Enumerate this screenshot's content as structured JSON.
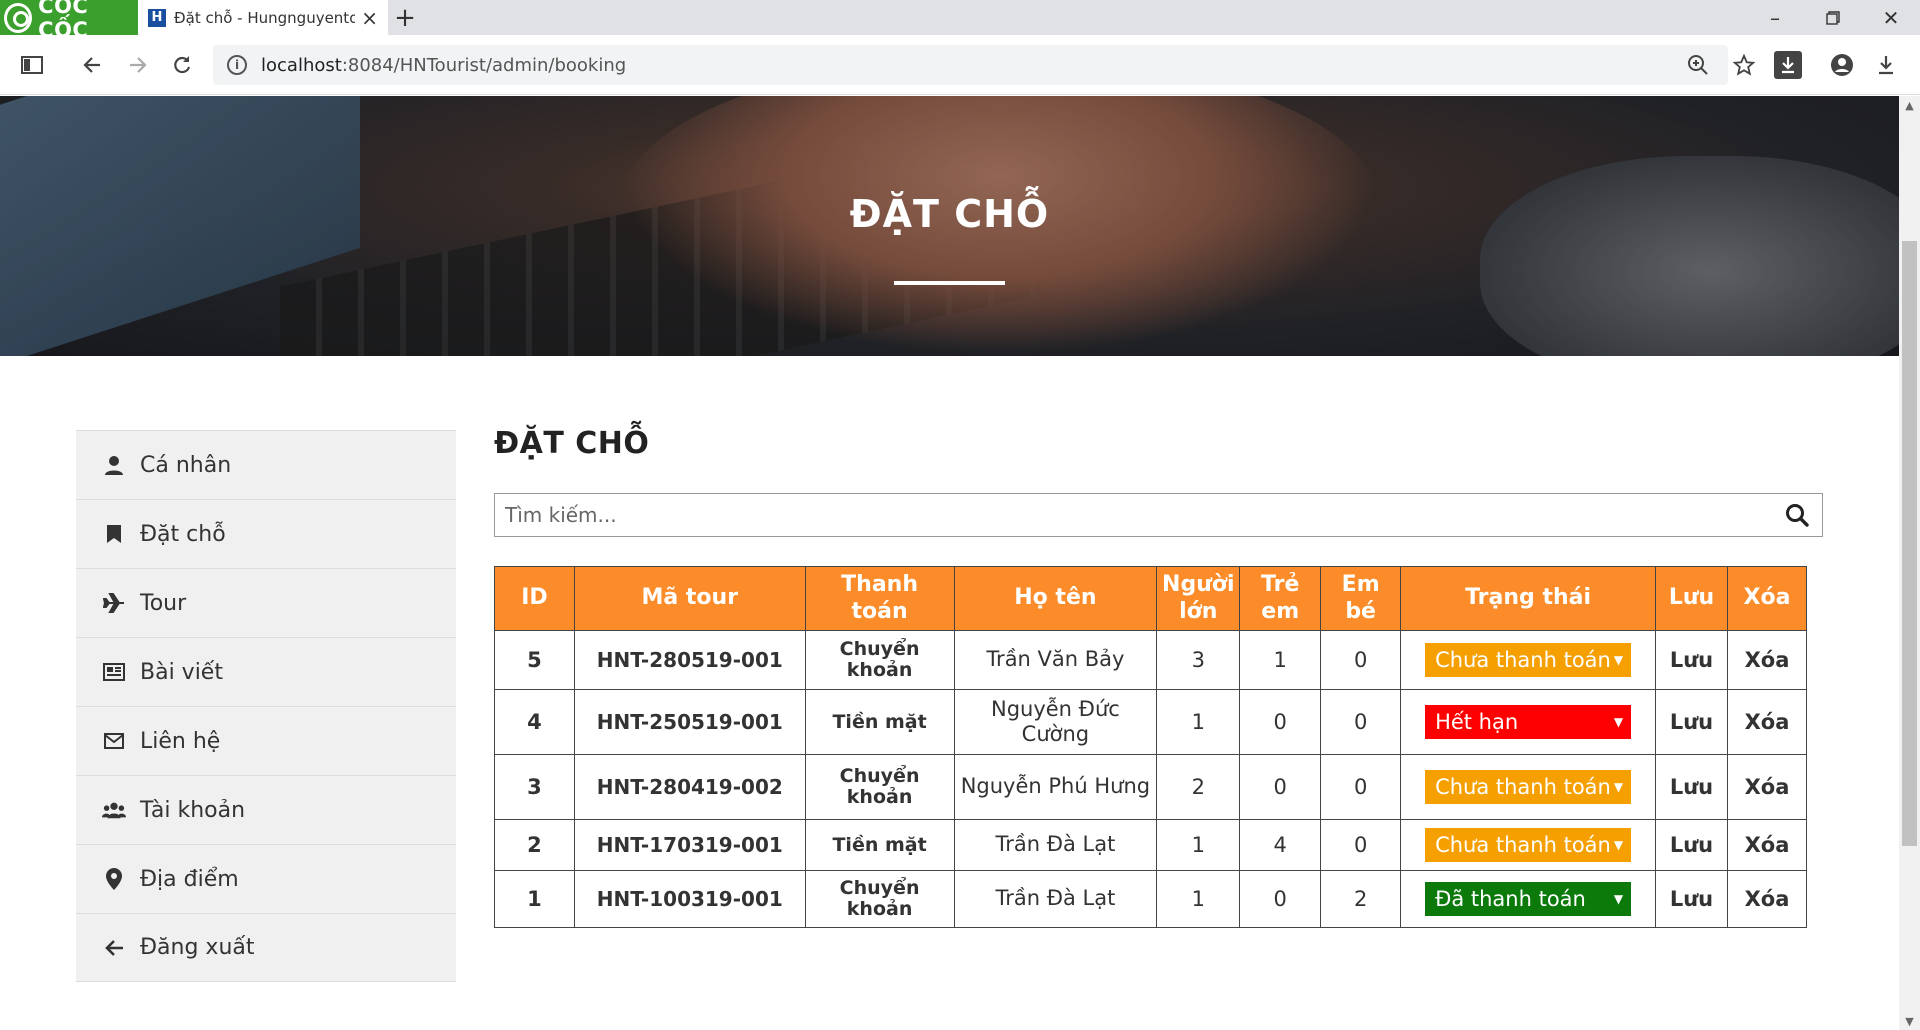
{
  "browser": {
    "brand": "CỐC CỐC",
    "tab_title": "Đặt chỗ - Hungnguyentou",
    "tab_favicon": "H",
    "url_host": "localhost",
    "url_path": ":8084/HNTourist/admin/booking"
  },
  "hero": {
    "title": "ĐẶT CHỖ"
  },
  "sidebar": {
    "items": [
      {
        "label": "Cá nhân",
        "icon": "user-icon"
      },
      {
        "label": "Đặt chỗ",
        "icon": "bookmark-icon"
      },
      {
        "label": "Tour",
        "icon": "plane-icon"
      },
      {
        "label": "Bài viết",
        "icon": "newspaper-icon"
      },
      {
        "label": "Liên hệ",
        "icon": "envelope-icon"
      },
      {
        "label": "Tài khoản",
        "icon": "users-icon"
      },
      {
        "label": "Địa điểm",
        "icon": "map-marker-icon"
      },
      {
        "label": "Đăng xuất",
        "icon": "arrow-left-icon"
      }
    ]
  },
  "main": {
    "title": "ĐẶT CHỖ",
    "search_placeholder": "Tìm kiếm..."
  },
  "table": {
    "headers": [
      "ID",
      "Mã tour",
      "Thanh toán",
      "Họ tên",
      "Người lớn",
      "Trẻ em",
      "Em bé",
      "Trạng thái",
      "Lưu",
      "Xóa"
    ],
    "rows": [
      {
        "id": "5",
        "code": "HNT-280519-001",
        "payment": "Chuyển khoản",
        "name": "Trần Văn Bảy",
        "adults": "3",
        "children": "1",
        "infants": "0",
        "status": "Chưa thanh toán",
        "status_color": "#f5a000",
        "save": "Lưu",
        "delete": "Xóa"
      },
      {
        "id": "4",
        "code": "HNT-250519-001",
        "payment": "Tiền mặt",
        "name": "Nguyễn Đức Cường",
        "adults": "1",
        "children": "0",
        "infants": "0",
        "status": "Hết hạn",
        "status_color": "#ff0000",
        "save": "Lưu",
        "delete": "Xóa"
      },
      {
        "id": "3",
        "code": "HNT-280419-002",
        "payment": "Chuyển khoản",
        "name": "Nguyễn Phú Hưng",
        "adults": "2",
        "children": "0",
        "infants": "0",
        "status": "Chưa thanh toán",
        "status_color": "#f5a000",
        "save": "Lưu",
        "delete": "Xóa"
      },
      {
        "id": "2",
        "code": "HNT-170319-001",
        "payment": "Tiền mặt",
        "name": "Trần Đà Lạt",
        "adults": "1",
        "children": "4",
        "infants": "0",
        "status": "Chưa thanh toán",
        "status_color": "#f5a000",
        "save": "Lưu",
        "delete": "Xóa"
      },
      {
        "id": "1",
        "code": "HNT-100319-001",
        "payment": "Chuyển khoản",
        "name": "Trần Đà Lạt",
        "adults": "1",
        "children": "0",
        "infants": "2",
        "status": "Đã thanh toán",
        "status_color": "#0b7a0b",
        "save": "Lưu",
        "delete": "Xóa"
      }
    ]
  },
  "colors": {
    "accent": "#fb8c29",
    "link": "#1565d8",
    "save": "#1d8a1d",
    "delete": "#e00000"
  }
}
